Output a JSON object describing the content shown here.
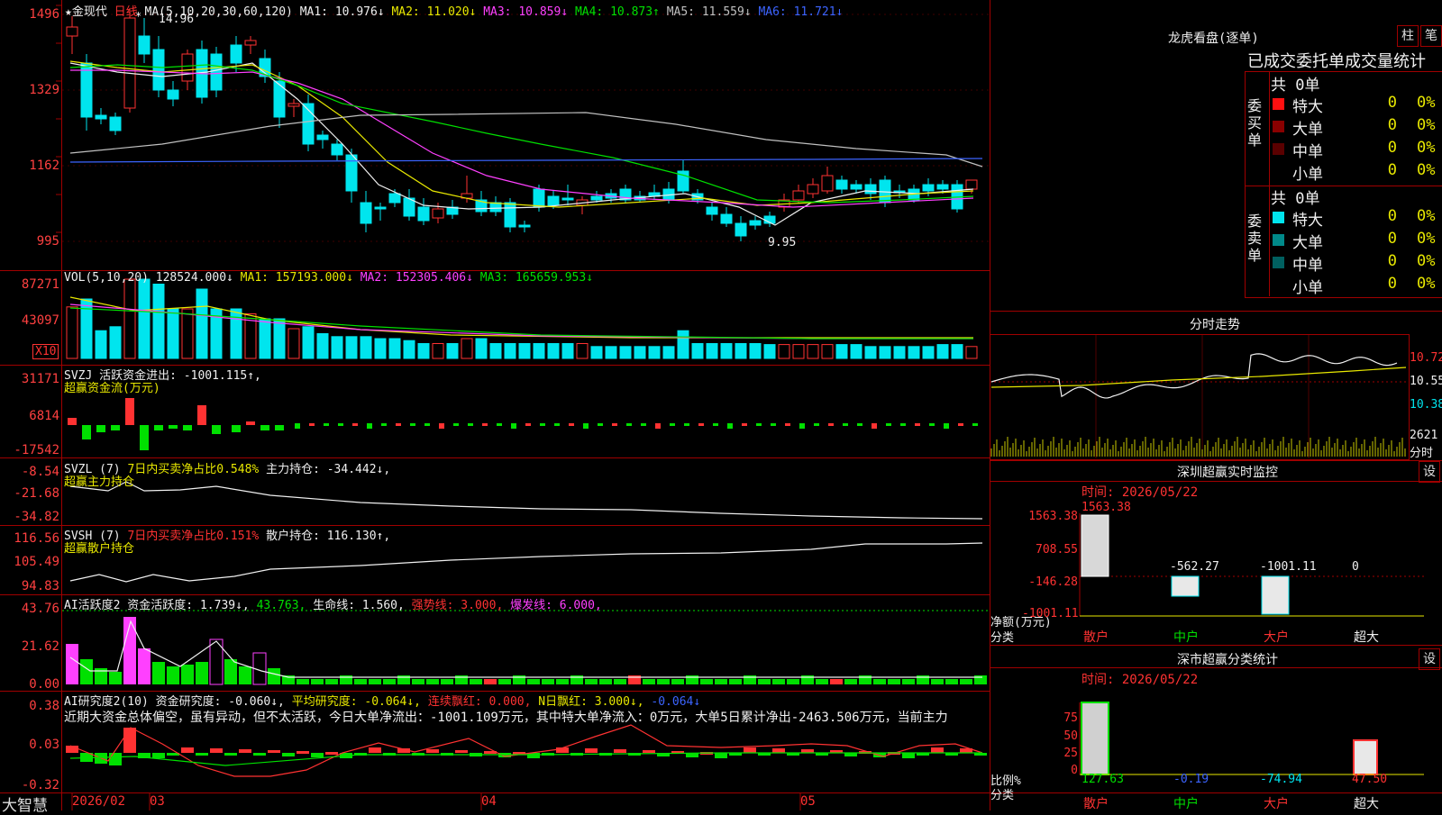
{
  "main": {
    "title": "★金现代",
    "period": "日线",
    "ma_params": "MA(5,10,20,30,60,120)",
    "ma": [
      {
        "label": "MA1: 10.976↓",
        "color": "#f0f0f0"
      },
      {
        "label": "MA2: 11.020↓",
        "color": "#e8e800"
      },
      {
        "label": "MA3: 10.859↓",
        "color": "#ff40ff"
      },
      {
        "label": "MA4: 10.873↑",
        "color": "#00e000"
      },
      {
        "label": "MA5: 11.559↓",
        "color": "#c0c0c0"
      },
      {
        "label": "MA6: 11.721↓",
        "color": "#3c64ff"
      }
    ],
    "axis": [
      "1496",
      "1329",
      "1162",
      "995"
    ],
    "high_label": "14.96",
    "low_label": "9.95"
  },
  "vol": {
    "header": "VOL(5,10,20)",
    "val": "128524.000↓",
    "ma1": "MA1: 157193.000↓",
    "ma2": "MA2: 152305.406↓",
    "ma3": "MA3: 165659.953↓",
    "axis": [
      "87271",
      "43097"
    ],
    "unit": "X10"
  },
  "svzj": {
    "header": "SVZJ  活跃资金进出: -1001.115↑,",
    "sub": "超赢资金流(万元)",
    "axis": [
      "31171",
      "6814",
      "-17542"
    ]
  },
  "svzl": {
    "header_a": "SVZL (7)",
    "header_b": "7日内买卖净占比0.548%",
    "header_c": "主力持仓: -34.442↓,",
    "sub": "超赢主力持仓",
    "axis": [
      "-8.54",
      "-21.68",
      "-34.82"
    ]
  },
  "svsh": {
    "header_a": "SVSH (7)",
    "header_b": "7日内买卖净占比0.151%",
    "header_c": "散户持仓: 116.130↑,",
    "sub": "超赢散户持仓",
    "axis": [
      "116.56",
      "105.49",
      "94.83"
    ]
  },
  "ai1": {
    "a": "AI活跃度2 资金活跃度: 1.739↓,",
    "b": "43.763,",
    "c": "生命线: 1.560,",
    "d": "强势线: 3.000,",
    "e": "爆发线: 6.000,",
    "axis": [
      "43.76",
      "21.62",
      "0.00"
    ]
  },
  "ai2": {
    "a": "AI研究度2(10) 资金研究度: -0.060↓,",
    "b": "平均研究度: -0.064↓,",
    "c": "连续飘红: 0.000,",
    "d": "N日飘红: 3.000↓,",
    "e": "-0.064↓",
    "text": "近期大资金总体偏空，虽有异动，但不太活跃，今日大单净流出：-1001.109万元，其中特大单净流入：0万元，大单5日累计净出-2463.506万元，当前主力",
    "axis": [
      "0.38",
      "0.03",
      "-0.32"
    ]
  },
  "bottom": {
    "brand": "大智慧",
    "dates": [
      "2026/02",
      "03",
      "04",
      "05"
    ]
  },
  "side": {
    "title": "龙虎看盘(逐单)",
    "btn1": "柱",
    "btn2": "笔",
    "tabs": "已成交委托单成交量统计",
    "buy_label": "委买单",
    "sell_label": "委卖单",
    "buy_total": "共 0单",
    "sell_total": "共 0单",
    "buy_rows": [
      {
        "name": "特大",
        "val": "0",
        "pct": "0%",
        "color": "#ff1010"
      },
      {
        "name": "大单",
        "val": "0",
        "pct": "0%",
        "color": "#8a0000"
      },
      {
        "name": "中单",
        "val": "0",
        "pct": "0%",
        "color": "#5a0000"
      },
      {
        "name": "小单",
        "val": "0",
        "pct": "0%",
        "color": "#000000"
      }
    ],
    "sell_rows": [
      {
        "name": "特大",
        "val": "0",
        "pct": "0%",
        "color": "#00e5ee"
      },
      {
        "name": "大单",
        "val": "0",
        "pct": "0%",
        "color": "#008a8a"
      },
      {
        "name": "中单",
        "val": "0",
        "pct": "0%",
        "color": "#006060"
      },
      {
        "name": "小单",
        "val": "0",
        "pct": "0%",
        "color": "#000000"
      }
    ],
    "fenshi_title": "分时走势",
    "fenshi_axis": [
      "10.72",
      "10.55",
      "10.38"
    ],
    "fenshi_vol": "2621",
    "fenshi_unit": "分时",
    "monitor_title": "深圳超赢实时监控",
    "monitor_btn": "设",
    "monitor_time": "时间: 2026/05/22",
    "monitor_axis": [
      "1563.38",
      "708.55",
      "-146.28",
      "-1001.11"
    ],
    "monitor_top_label": "1563.38",
    "monitor_values": [
      "-562.27",
      "-1001.11",
      "0"
    ],
    "monitor_ylabel": "净额(万元)",
    "monitor_xlabel": "分类",
    "cats": [
      "散户",
      "中户",
      "大户",
      "超大"
    ],
    "stat_title": "深市超赢分类统计",
    "stat_btn": "设",
    "stat_time": "时间: 2026/05/22",
    "stat_axis": [
      "75",
      "50",
      "25",
      "0"
    ],
    "stat_values": [
      "127.63",
      "-0.19",
      "-74.94",
      "47.50"
    ],
    "stat_ylabel": "比例%",
    "stat_xlabel": "分类"
  }
}
